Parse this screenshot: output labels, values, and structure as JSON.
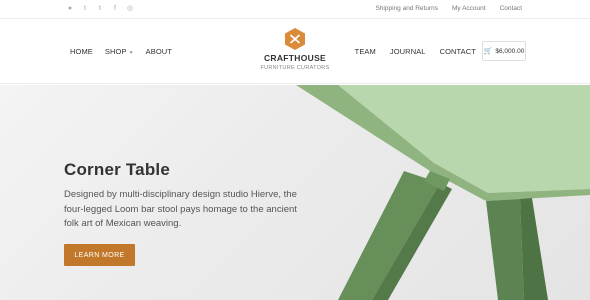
{
  "topbar": {
    "social": [
      {
        "icon": "apple-icon",
        "glyph": ""
      },
      {
        "icon": "twitter-icon",
        "glyph": "t"
      },
      {
        "icon": "tumblr-icon",
        "glyph": "t"
      },
      {
        "icon": "facebook-icon",
        "glyph": "f"
      },
      {
        "icon": "dribbble-icon",
        "glyph": "◎"
      }
    ],
    "links": [
      "Shipping and Returns",
      "My Account",
      "Contact"
    ]
  },
  "nav": {
    "home": "HOME",
    "shop": "SHOP",
    "about": "ABOUT",
    "team": "TEAM",
    "journal": "JOURNAL",
    "contact": "CONTACT"
  },
  "cart": {
    "amount": "$6,000.00"
  },
  "logo": {
    "name": "CRAFTHOUSE",
    "tagline": "FURNITURE CURATORS"
  },
  "hero": {
    "title": "Corner Table",
    "description": "Designed by multi-disciplinary design studio Hierve, the four-legged Loom bar stool pays homage to the ancient folk art of Mexican weaving.",
    "button": "LEARN MORE"
  },
  "colors": {
    "accent": "#c2782b",
    "table_top": "#b9d7ad",
    "table_leg": "#5d8352"
  }
}
